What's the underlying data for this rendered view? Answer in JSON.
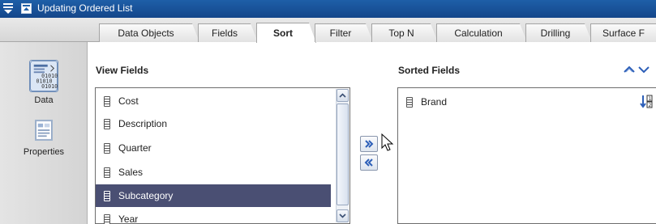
{
  "window": {
    "title": "Updating Ordered List"
  },
  "tabs": [
    {
      "label": "Data Objects",
      "active": false
    },
    {
      "label": "Fields",
      "active": false
    },
    {
      "label": "Sort",
      "active": true
    },
    {
      "label": "Filter",
      "active": false
    },
    {
      "label": "Top N",
      "active": false
    },
    {
      "label": "Calculation",
      "active": false
    },
    {
      "label": "Drilling",
      "active": false
    },
    {
      "label": "Surface F",
      "active": false
    }
  ],
  "sidebar": {
    "items": [
      {
        "label": "Data",
        "icon": "data-binary-icon",
        "selected": true
      },
      {
        "label": "Properties",
        "icon": "properties-icon",
        "selected": false
      }
    ]
  },
  "view_fields": {
    "label": "View Fields",
    "items": [
      {
        "label": "Cost",
        "selected": false
      },
      {
        "label": "Description",
        "selected": false
      },
      {
        "label": "Quarter",
        "selected": false
      },
      {
        "label": "Sales",
        "selected": false
      },
      {
        "label": "Subcategory",
        "selected": true
      },
      {
        "label": "Year",
        "selected": false
      }
    ]
  },
  "sorted_fields": {
    "label": "Sorted Fields",
    "items": [
      {
        "label": "Brand",
        "sort_direction_icon": "sort-ascending-icon"
      }
    ]
  },
  "colors": {
    "titlebar": "#1e5fa8",
    "selection": "#4a4f73",
    "arrow_blue": "#2d5fb8"
  }
}
